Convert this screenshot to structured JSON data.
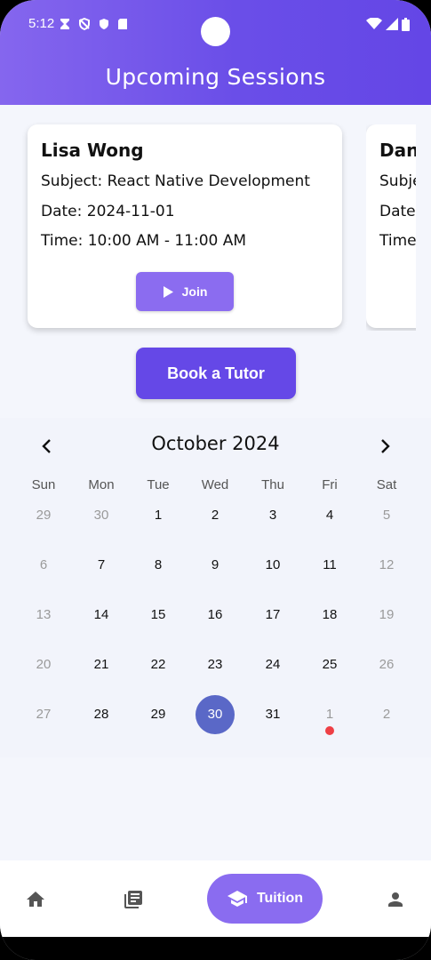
{
  "status": {
    "time": "5:12",
    "icons": [
      "hourglass-icon",
      "shield-off-icon",
      "shield-icon",
      "sdcard-icon"
    ],
    "right_icons": [
      "wifi-icon",
      "signal-icon",
      "battery-icon"
    ]
  },
  "header": {
    "title": "Upcoming Sessions"
  },
  "sessions": [
    {
      "name": "Lisa Wong",
      "subject": "Subject: React Native Development",
      "date": "Date: 2024-11-01",
      "time": "Time: 10:00 AM - 11:00 AM",
      "join_label": "Join"
    },
    {
      "name": "Dan",
      "subject": "Subje",
      "date": "Date",
      "time": "Time"
    }
  ],
  "book_button": {
    "label": "Book a Tutor"
  },
  "calendar": {
    "month_label": "October 2024",
    "weekdays": [
      "Sun",
      "Mon",
      "Tue",
      "Wed",
      "Thu",
      "Fri",
      "Sat"
    ],
    "weeks": [
      [
        "29",
        "30",
        "1",
        "2",
        "3",
        "4",
        "5"
      ],
      [
        "6",
        "7",
        "8",
        "9",
        "10",
        "11",
        "12"
      ],
      [
        "13",
        "14",
        "15",
        "16",
        "17",
        "18",
        "19"
      ],
      [
        "20",
        "21",
        "22",
        "23",
        "24",
        "25",
        "26"
      ],
      [
        "27",
        "28",
        "29",
        "30",
        "31",
        "1",
        "2"
      ]
    ],
    "selected_day": "30",
    "marked_day": "1 (November)",
    "colors": {
      "selected": "#5A68C7",
      "event_dot": "#EE3F45"
    }
  },
  "bottom_nav": {
    "items": [
      {
        "icon": "home-icon"
      },
      {
        "icon": "book-icon"
      },
      {
        "icon": "graduation-cap-icon",
        "label": "Tuition",
        "active": true
      },
      {
        "icon": "person-icon"
      }
    ]
  },
  "colors": {
    "accent": "#6548E7",
    "accent_light": "#8B6CF0"
  }
}
